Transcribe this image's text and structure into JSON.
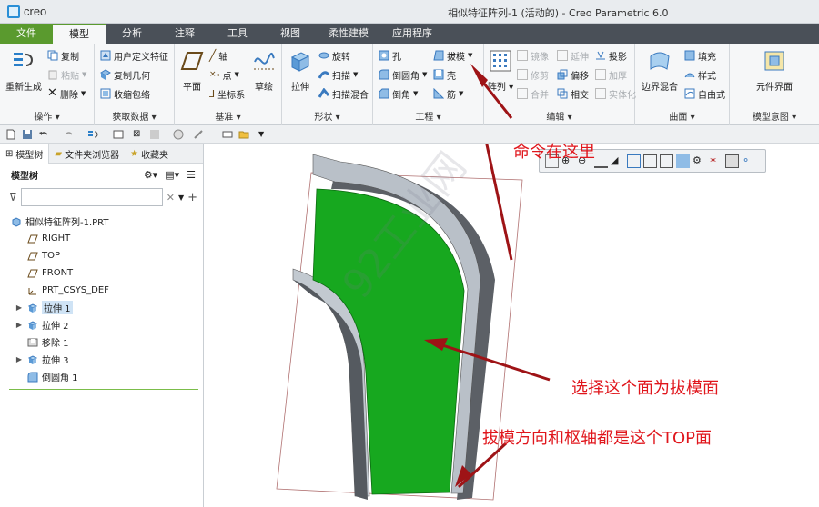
{
  "app": {
    "logo_text": "creo",
    "window_title": "相似特征阵列-1 (活动的) - Creo Parametric 6.0"
  },
  "tabs": [
    {
      "label": "文件"
    },
    {
      "label": "模型"
    },
    {
      "label": "分析"
    },
    {
      "label": "注释"
    },
    {
      "label": "工具"
    },
    {
      "label": "视图"
    },
    {
      "label": "柔性建模"
    },
    {
      "label": "应用程序"
    }
  ],
  "ribbon": {
    "operations": {
      "regenerate": "重新生成",
      "copy": "复制",
      "paste": "粘贴",
      "delete": "删除",
      "group": "操作"
    },
    "get_data": {
      "udf": "用户定义特征",
      "copy_geometry": "复制几何",
      "shrinkwrap": "收缩包络",
      "group": "获取数据"
    },
    "datum": {
      "plane": "平面",
      "axis": "轴",
      "point": "点",
      "csys": "坐标系",
      "sketch": "草绘",
      "group": "基准"
    },
    "shapes": {
      "extrude": "拉伸",
      "revolve": "旋转",
      "sweep": "扫描",
      "swept_blend": "扫描混合",
      "group": "形状"
    },
    "engineering": {
      "hole": "孔",
      "round": "倒圆角",
      "chamfer": "倒角",
      "draft": "拔模",
      "shell": "壳",
      "rib": "筋",
      "group": "工程"
    },
    "editing": {
      "pattern": "阵列",
      "mirror": "镜像",
      "trim": "修剪",
      "merge": "合并",
      "extend": "延伸",
      "offset": "偏移",
      "intersect": "相交",
      "project": "投影",
      "thicken": "加厚",
      "solidify": "实体化",
      "group": "编辑"
    },
    "surfaces": {
      "boundary_blend": "边界混合",
      "fill": "填充",
      "style": "样式",
      "freestyle": "自由式",
      "group": "曲面"
    },
    "model_intent": {
      "component_interface": "元件界面",
      "group": "模型意图"
    }
  },
  "left_panel": {
    "tabs": [
      {
        "label": "模型树"
      },
      {
        "label": "文件夹浏览器"
      },
      {
        "label": "收藏夹"
      }
    ],
    "tree_header": "模型树",
    "search_placeholder": "",
    "tree_items": [
      {
        "label": "相似特征阵列-1.PRT",
        "icon": "part-icon",
        "expandable": false,
        "indent": 0,
        "selected": false
      },
      {
        "label": "RIGHT",
        "icon": "datum-plane-icon",
        "expandable": false,
        "indent": 1,
        "selected": false
      },
      {
        "label": "TOP",
        "icon": "datum-plane-icon",
        "expandable": false,
        "indent": 1,
        "selected": false
      },
      {
        "label": "FRONT",
        "icon": "datum-plane-icon",
        "expandable": false,
        "indent": 1,
        "selected": false
      },
      {
        "label": "PRT_CSYS_DEF",
        "icon": "csys-icon",
        "expandable": false,
        "indent": 1,
        "selected": false
      },
      {
        "label": "拉伸 1",
        "icon": "extrude-icon",
        "expandable": true,
        "indent": 1,
        "selected": true
      },
      {
        "label": "拉伸 2",
        "icon": "extrude-icon",
        "expandable": true,
        "indent": 1,
        "selected": false
      },
      {
        "label": "移除 1",
        "icon": "remove-icon",
        "expandable": false,
        "indent": 1,
        "selected": false
      },
      {
        "label": "拉伸 3",
        "icon": "extrude-icon",
        "expandable": true,
        "indent": 1,
        "selected": false
      },
      {
        "label": "倒圆角 1",
        "icon": "round-icon",
        "expandable": false,
        "indent": 1,
        "selected": false
      }
    ]
  },
  "annotations": {
    "command_here": "命令在这里",
    "select_face": "选择这个面为拔模面",
    "direction_pivot": "拔模方向和枢轴都是这个TOP面"
  },
  "watermark": "92工业网",
  "colors": {
    "accent_green": "#5a9a2e",
    "tab_bar": "#4a5058",
    "draft_surface": "#17a81f",
    "annotation_red": "#e0161c",
    "arrow_dark_red": "#9e1316"
  }
}
